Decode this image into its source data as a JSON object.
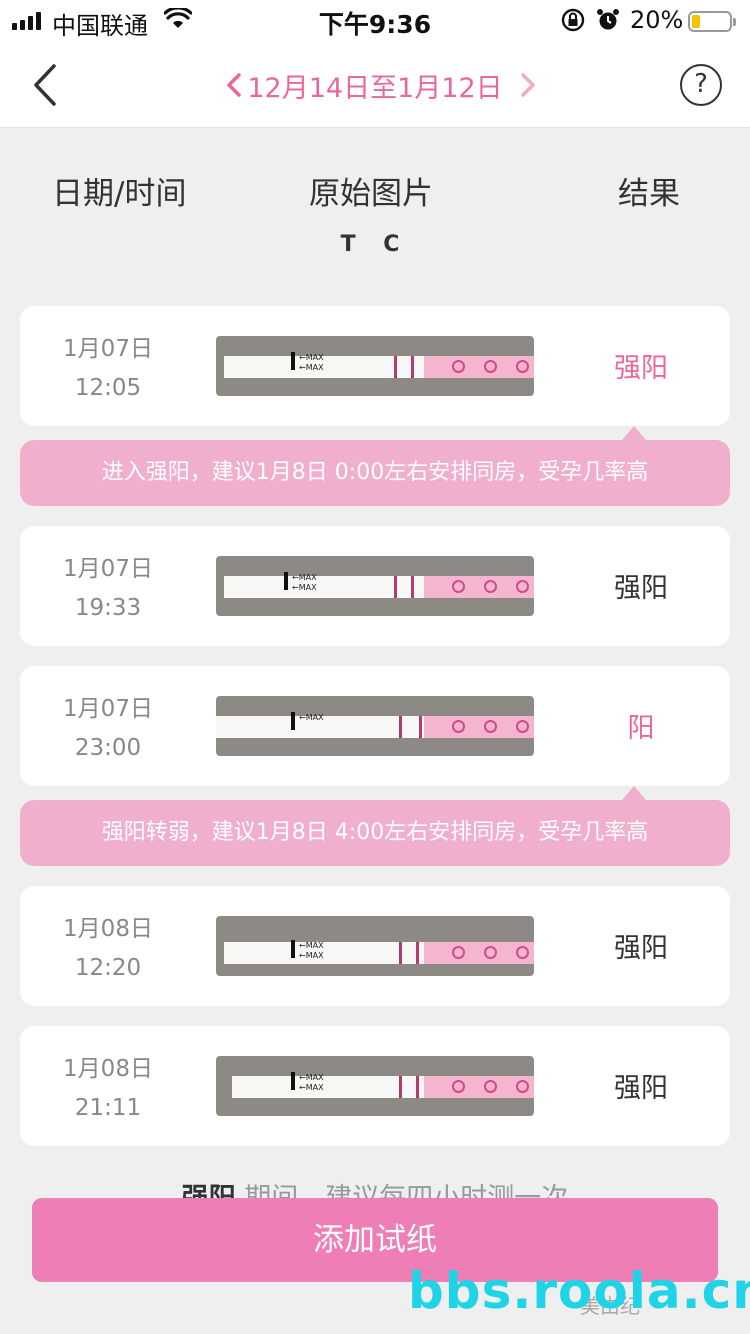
{
  "status_bar": {
    "carrier": "中国联通",
    "time": "下午9:36",
    "battery_pct": "20%"
  },
  "nav": {
    "range": "12月14日至1月12日",
    "help": "?"
  },
  "columns": {
    "datetime": "日期/时间",
    "image": "原始图片",
    "result": "结果",
    "tc": "T C"
  },
  "records": [
    {
      "date": "1月07日",
      "time": "12:05",
      "result": "强阳",
      "highlight": true
    },
    {
      "date": "1月07日",
      "time": "19:33",
      "result": "强阳",
      "highlight": false
    },
    {
      "date": "1月07日",
      "time": "23:00",
      "result": "阳",
      "highlight": true
    },
    {
      "date": "1月08日",
      "time": "12:20",
      "result": "强阳",
      "highlight": false
    },
    {
      "date": "1月08日",
      "time": "21:11",
      "result": "强阳",
      "highlight": false
    }
  ],
  "tips": [
    "进入强阳，建议1月8日 0:00左右安排同房，受孕几率高",
    "强阳转弱，建议1月8日 4:00左右安排同房，受孕几率高"
  ],
  "footer": {
    "strong": "强阳",
    "note": " 期间，建议每四小时测一次"
  },
  "add_button": "添加试纸",
  "watermark": "bbs.roola.cn",
  "watermark_faint": "美由纪",
  "colors": {
    "accent": "#e8679f",
    "button": "#ee7eb5",
    "tip_bg": "#f0afcd",
    "watermark": "#1ed4e6"
  }
}
